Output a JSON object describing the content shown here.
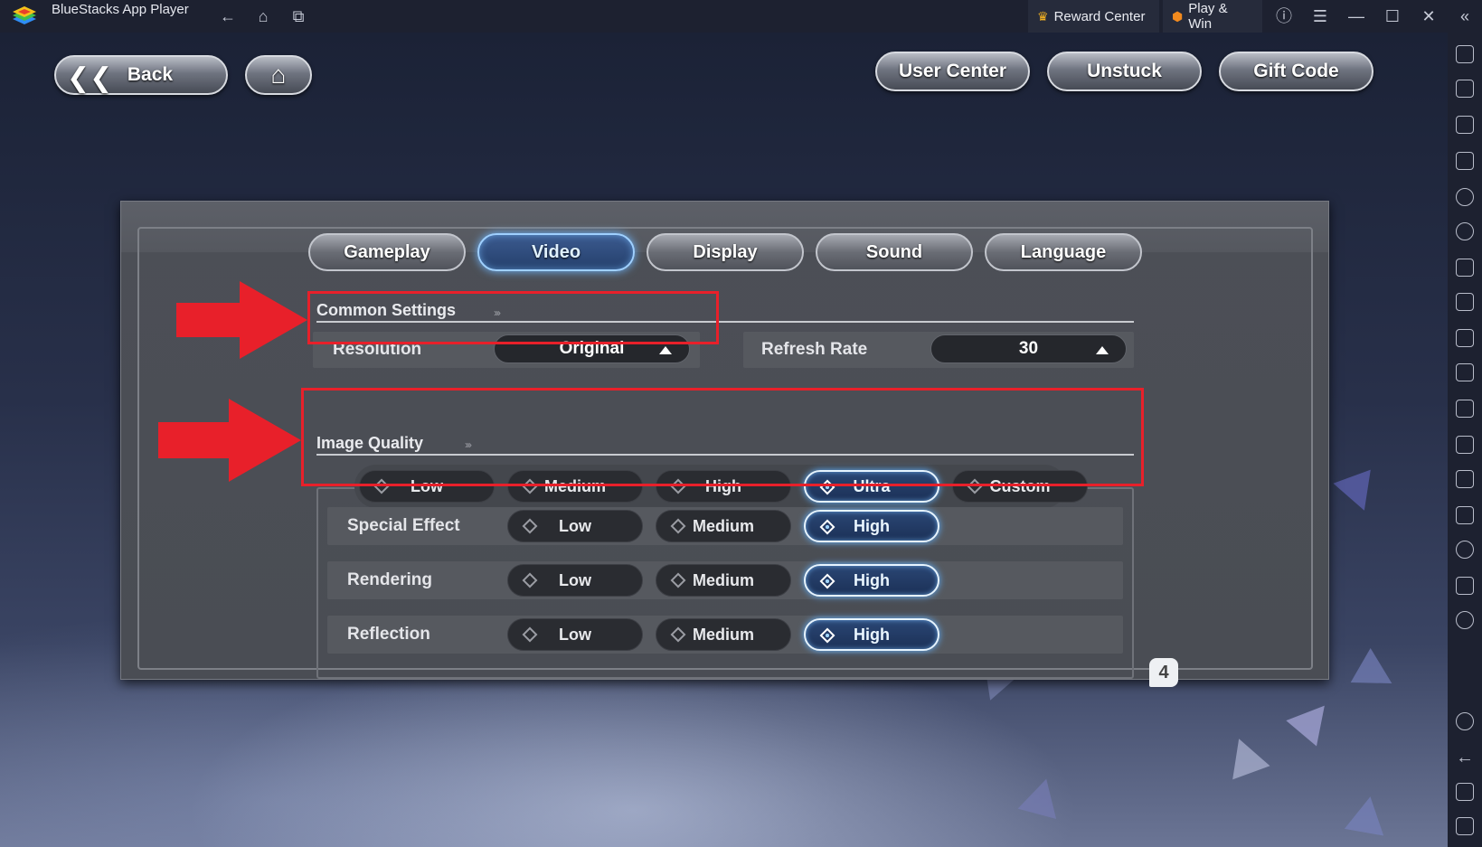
{
  "window": {
    "app_title": "BlueStacks App Player",
    "reward_center_label": "Reward Center",
    "play_win_label": "Play & Win"
  },
  "top_buttons": {
    "back_label": "Back",
    "user_center_label": "User Center",
    "unstuck_label": "Unstuck",
    "gift_code_label": "Gift Code"
  },
  "tabs": [
    {
      "label": "Gameplay",
      "active": false
    },
    {
      "label": "Video",
      "active": true
    },
    {
      "label": "Display",
      "active": false
    },
    {
      "label": "Sound",
      "active": false
    },
    {
      "label": "Language",
      "active": false
    }
  ],
  "common_settings": {
    "title": "Common Settings",
    "resolution_label": "Resolution",
    "resolution_value": "Original",
    "refresh_rate_label": "Refresh Rate",
    "refresh_rate_value": "30"
  },
  "image_quality": {
    "title": "Image Quality",
    "presets": [
      "Low",
      "Medium",
      "High",
      "Ultra",
      "Custom"
    ],
    "selected_preset": "Ultra",
    "rows": [
      {
        "label": "Special Effect",
        "options": [
          "Low",
          "Medium",
          "High"
        ],
        "selected": "High"
      },
      {
        "label": "Rendering",
        "options": [
          "Low",
          "Medium",
          "High"
        ],
        "selected": "High"
      },
      {
        "label": "Reflection",
        "options": [
          "Low",
          "Medium",
          "High"
        ],
        "selected": "High"
      }
    ]
  },
  "badge_number": "4",
  "colors": {
    "annotation_red": "#e8202a",
    "selected_glow": "#6fb7ff"
  }
}
